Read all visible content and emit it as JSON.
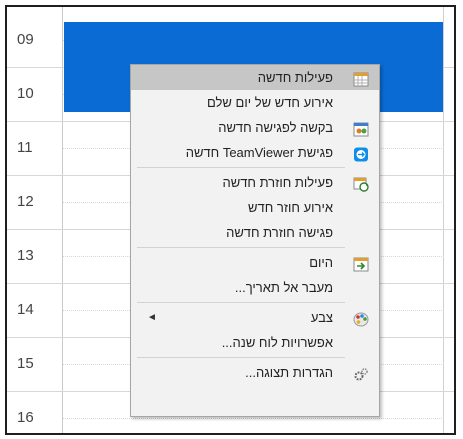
{
  "calendar": {
    "hours": [
      "09",
      "10",
      "11",
      "12",
      "13",
      "14",
      "15",
      "16"
    ],
    "selection_color": "#0a6bd4"
  },
  "context_menu": {
    "items": [
      {
        "label": "פעילות חדשה",
        "icon": "calendar-grid-icon",
        "highlighted": true
      },
      {
        "label": "אירוע חדש של יום שלם",
        "icon": null
      },
      {
        "label": "בקשה לפגישה חדשה",
        "icon": "meeting-request-icon"
      },
      {
        "label": "פגישת TeamViewer חדשה",
        "icon": "teamviewer-icon"
      },
      {
        "label": "פעילות חוזרת חדשה",
        "icon": "recurring-icon"
      },
      {
        "label": "אירוע חוזר חדש",
        "icon": null
      },
      {
        "label": "פגישה חוזרת חדשה",
        "icon": null
      },
      {
        "label": "היום",
        "icon": "today-icon"
      },
      {
        "label": "מעבר אל תאריך...",
        "icon": null
      },
      {
        "label": "צבע",
        "icon": "palette-icon",
        "submenu": true
      },
      {
        "label": "אפשרויות לוח שנה...",
        "icon": null
      },
      {
        "label": "הגדרות תצוגה...",
        "icon": "gears-icon"
      }
    ]
  }
}
